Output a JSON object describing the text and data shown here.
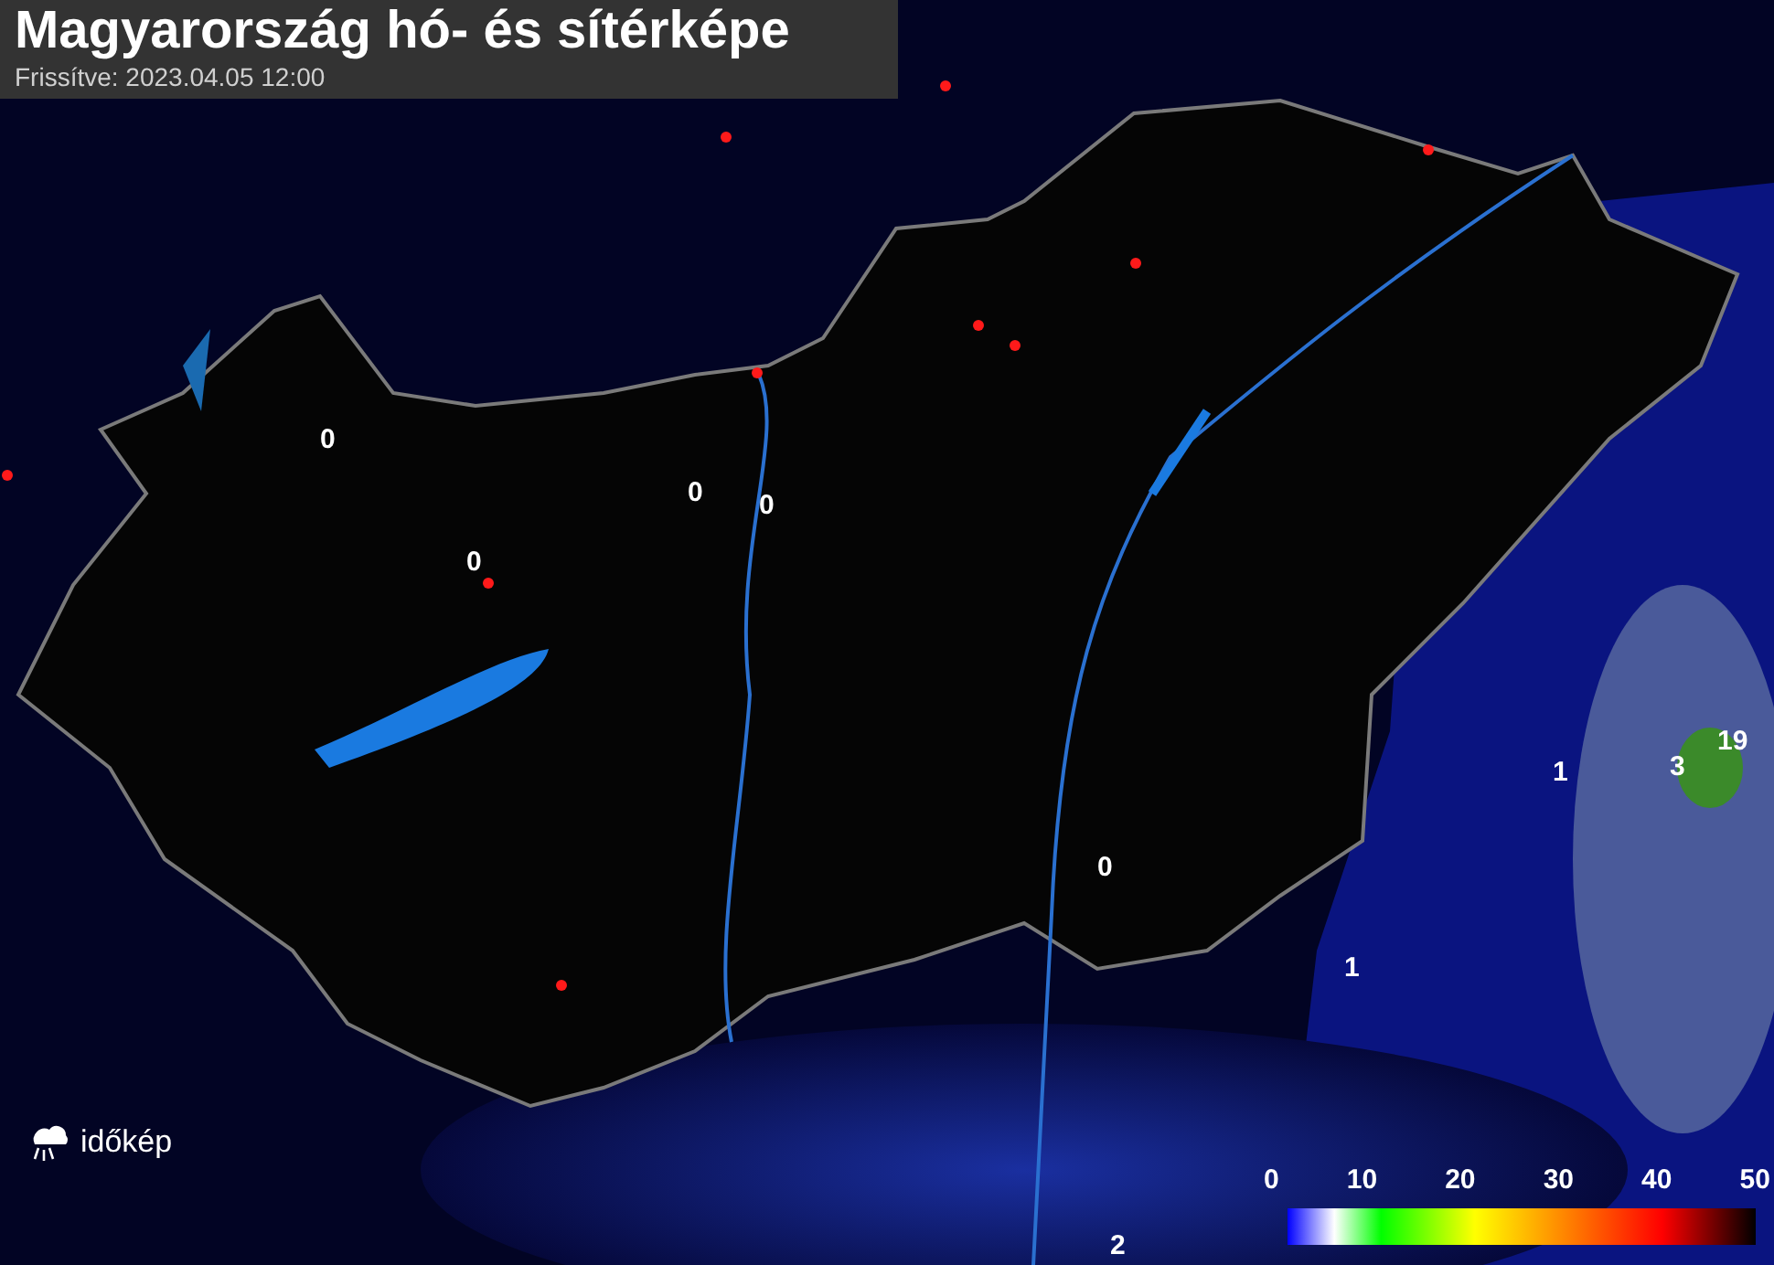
{
  "header": {
    "title": "Magyarország hó- és sítérképe",
    "updated": "Frissítve: 2023.04.05 12:00"
  },
  "map": {
    "values": [
      {
        "text": "0"
      },
      {
        "text": "0"
      },
      {
        "text": "0"
      },
      {
        "text": "0"
      },
      {
        "text": "0"
      },
      {
        "text": "1"
      },
      {
        "text": "3"
      },
      {
        "text": "19"
      },
      {
        "text": "1"
      },
      {
        "text": "2"
      }
    ]
  },
  "logo": {
    "text": "időkép"
  },
  "legend": {
    "ticks": [
      "0",
      "10",
      "20",
      "30",
      "40",
      "50"
    ]
  }
}
